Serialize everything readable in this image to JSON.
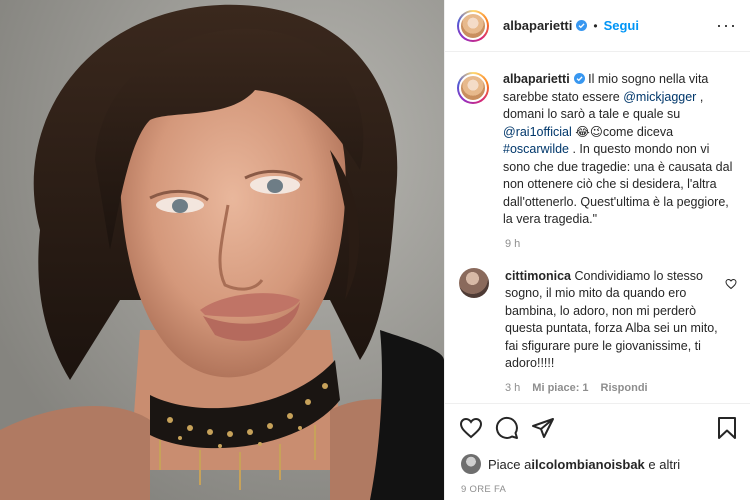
{
  "post": {
    "username": "albaparietti",
    "dot": "•",
    "follow_label": "Segui",
    "more_label": "···"
  },
  "caption": {
    "username": "albaparietti",
    "t1": " Il mio sogno nella vita sarebbe stato essere ",
    "m1": "@mickjagger",
    "t2": " , domani lo sarò a tale e quale su ",
    "m2": "@rai1official",
    "t3": " 😂😉come diceva ",
    "m3": "#oscarwilde",
    "t4": " . In questo mondo non vi sono che due tragedie: una è causata dal non ottenere ciò che si desidera, l'altra dall'ottenerlo. Quest'ultima è la peggiore, la vera tragedia.\"",
    "time": "9 h"
  },
  "comment": {
    "username": "cittimonica",
    "text": " Condividiamo lo stesso sogno, il mio mito da quando ero bambina, lo adoro, non mi perderò questa puntata, forza Alba sei un mito, fai sfigurare pure le giovanissime, ti adoro!!!!!",
    "time": "3 h",
    "likes": "Mi piace: 1",
    "reply": "Rispondi"
  },
  "actions": {
    "like_icon": "heart-icon",
    "comment_icon": "comment-icon",
    "share_icon": "share-icon",
    "save_icon": "bookmark-icon"
  },
  "likes": {
    "prefix": "Piace a ",
    "user": "ilcolombianoisbak",
    "suffix": " e altri"
  },
  "date": "9 ORE FA",
  "colors": {
    "link": "#0095f6",
    "mention": "#00376b",
    "muted": "#8e8e8e",
    "text": "#262626"
  }
}
